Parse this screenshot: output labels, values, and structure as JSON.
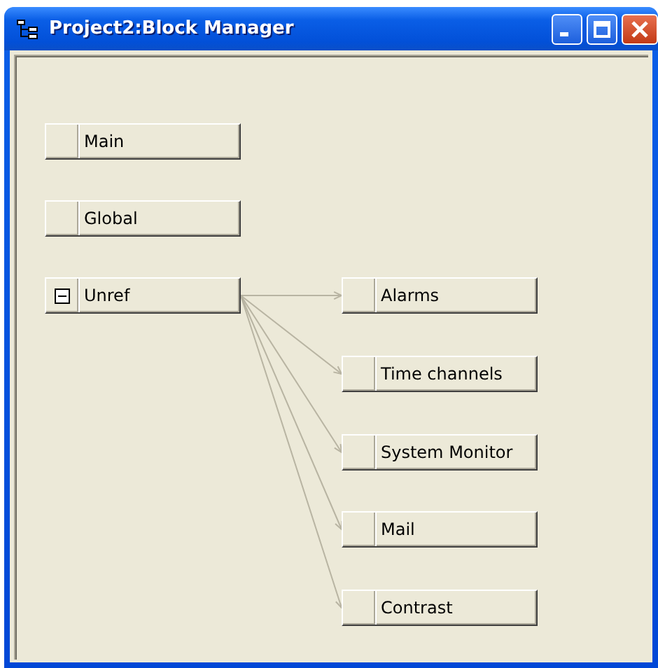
{
  "window": {
    "title": "Project2:Block Manager"
  },
  "blocks": [
    {
      "label": "Main"
    },
    {
      "label": "Global"
    },
    {
      "label": "Unref",
      "expanded": true,
      "children": [
        {
          "label": "Alarms"
        },
        {
          "label": "Time channels"
        },
        {
          "label": "System Monitor"
        },
        {
          "label": "Mail"
        },
        {
          "label": "Contrast"
        }
      ]
    }
  ]
}
